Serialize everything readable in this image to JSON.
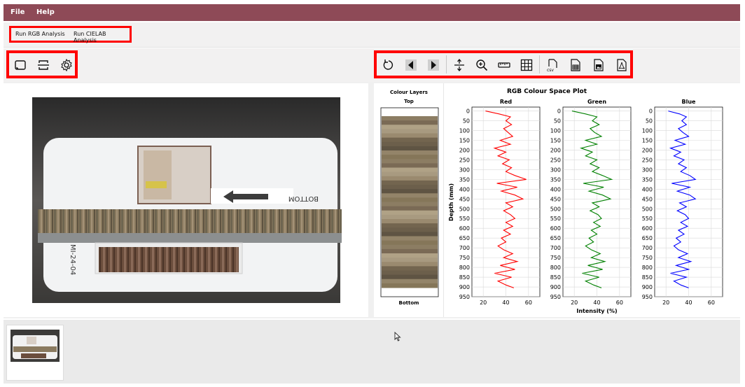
{
  "menu": {
    "file": "File",
    "help": "Help"
  },
  "ribbon": {
    "rgb": "Run RGB Analysis",
    "cielab": "Run CIELAB Analysis"
  },
  "toolbar_left": [
    "frame-icon",
    "crop-icon",
    "settings-icon"
  ],
  "toolbar_right": [
    "reset-icon",
    "previous-icon",
    "next-icon",
    "fit-vertical-icon",
    "zoom-in-icon",
    "ruler-icon",
    "grid-icon",
    "export-csv-icon",
    "export-table-icon",
    "export-image-icon",
    "export-pdf-icon"
  ],
  "csv_label": "csv",
  "layers": {
    "title": "Colour Layers",
    "top": "Top",
    "bottom": "Bottom"
  },
  "photo": {
    "label_bottom": "BOTTOM",
    "core_id": "MI-24-04"
  },
  "chart_data": {
    "type": "line",
    "title": "RGB Colour Space Plot",
    "ylabel": "Depth (mm)",
    "xlabel": "Intensity (%)",
    "ylim": [
      950,
      -20
    ],
    "xlim": [
      10,
      70
    ],
    "yticks": [
      0,
      50,
      100,
      150,
      200,
      250,
      300,
      350,
      400,
      450,
      500,
      550,
      600,
      650,
      700,
      750,
      800,
      850,
      900,
      950
    ],
    "xticks": [
      20,
      40,
      60
    ],
    "grid": true,
    "panels": [
      {
        "name": "Red",
        "color": "#ff0000",
        "depth": [
          0,
          15,
          30,
          50,
          70,
          90,
          110,
          130,
          150,
          170,
          190,
          210,
          230,
          250,
          270,
          290,
          310,
          330,
          350,
          370,
          390,
          410,
          430,
          450,
          470,
          490,
          510,
          530,
          550,
          570,
          590,
          610,
          630,
          650,
          670,
          690,
          710,
          730,
          750,
          770,
          790,
          810,
          830,
          850,
          870,
          890,
          905
        ],
        "values": [
          22,
          34,
          44,
          40,
          45,
          38,
          42,
          46,
          35,
          44,
          30,
          40,
          33,
          43,
          37,
          45,
          40,
          48,
          58,
          32,
          50,
          36,
          48,
          55,
          40,
          46,
          38,
          44,
          48,
          40,
          46,
          38,
          44,
          36,
          40,
          33,
          38,
          46,
          38,
          50,
          35,
          48,
          30,
          45,
          33,
          40,
          47
        ]
      },
      {
        "name": "Green",
        "color": "#008000",
        "depth": [
          0,
          15,
          30,
          50,
          70,
          90,
          110,
          130,
          150,
          170,
          190,
          210,
          230,
          250,
          270,
          290,
          310,
          330,
          350,
          370,
          390,
          410,
          430,
          450,
          470,
          490,
          510,
          530,
          550,
          570,
          590,
          610,
          630,
          650,
          670,
          690,
          710,
          730,
          750,
          770,
          790,
          810,
          830,
          850,
          870,
          890,
          905
        ],
        "values": [
          18,
          30,
          40,
          36,
          42,
          34,
          38,
          44,
          30,
          40,
          26,
          36,
          30,
          40,
          34,
          42,
          36,
          45,
          53,
          28,
          46,
          33,
          45,
          52,
          36,
          42,
          34,
          41,
          44,
          37,
          43,
          35,
          40,
          33,
          37,
          30,
          35,
          43,
          35,
          47,
          32,
          45,
          27,
          42,
          30,
          37,
          44
        ]
      },
      {
        "name": "Blue",
        "color": "#0000ff",
        "depth": [
          0,
          15,
          30,
          50,
          70,
          90,
          110,
          130,
          150,
          170,
          190,
          210,
          230,
          250,
          270,
          290,
          310,
          330,
          350,
          370,
          390,
          410,
          430,
          450,
          470,
          490,
          510,
          530,
          550,
          570,
          590,
          610,
          630,
          650,
          670,
          690,
          710,
          730,
          750,
          770,
          790,
          810,
          830,
          850,
          870,
          890,
          905
        ],
        "values": [
          22,
          32,
          38,
          34,
          38,
          31,
          35,
          40,
          28,
          37,
          24,
          33,
          27,
          36,
          31,
          38,
          33,
          41,
          46,
          25,
          41,
          30,
          41,
          46,
          32,
          38,
          30,
          37,
          40,
          33,
          39,
          31,
          36,
          29,
          33,
          27,
          31,
          39,
          31,
          42,
          29,
          40,
          24,
          38,
          27,
          33,
          40
        ]
      }
    ]
  }
}
